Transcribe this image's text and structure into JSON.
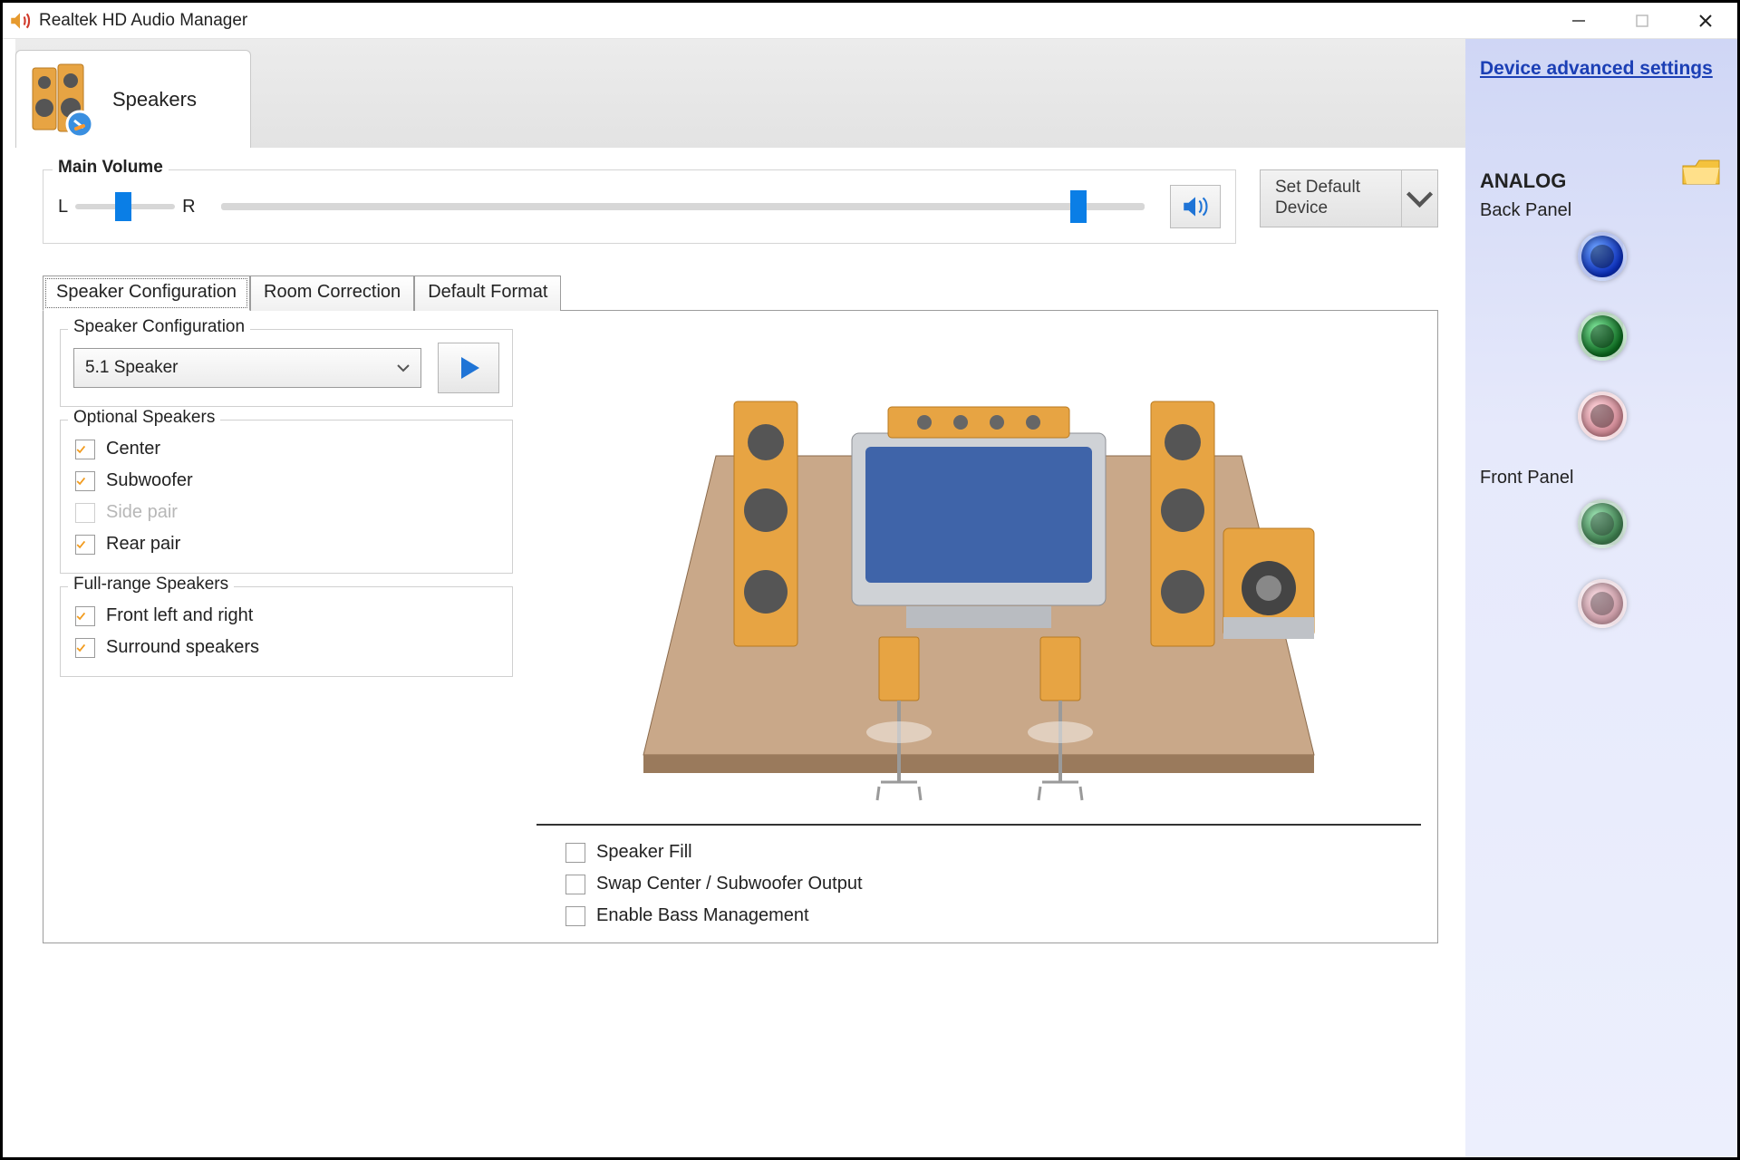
{
  "window": {
    "title": "Realtek HD Audio Manager"
  },
  "device_tab": {
    "label": "Speakers"
  },
  "main_volume": {
    "legend": "Main Volume",
    "left_label": "L",
    "right_label": "R",
    "balance_percent": 45,
    "volume_percent": 92,
    "default_device_label": "Set Default\nDevice"
  },
  "inner_tabs": {
    "items": [
      "Speaker Configuration",
      "Room Correction",
      "Default Format"
    ],
    "active_index": 0
  },
  "speaker_config": {
    "legend": "Speaker Configuration",
    "selected": "5.1 Speaker"
  },
  "optional_speakers": {
    "legend": "Optional Speakers",
    "items": [
      {
        "label": "Center",
        "checked": true,
        "disabled": false
      },
      {
        "label": "Subwoofer",
        "checked": true,
        "disabled": false
      },
      {
        "label": "Side pair",
        "checked": false,
        "disabled": true
      },
      {
        "label": "Rear pair",
        "checked": true,
        "disabled": false
      }
    ]
  },
  "full_range": {
    "legend": "Full-range Speakers",
    "items": [
      {
        "label": "Front left and right",
        "checked": true
      },
      {
        "label": "Surround speakers",
        "checked": true
      }
    ]
  },
  "extra_options": {
    "items": [
      {
        "label": "Speaker Fill",
        "checked": false
      },
      {
        "label": "Swap Center / Subwoofer Output",
        "checked": false
      },
      {
        "label": "Enable Bass Management",
        "checked": false
      }
    ]
  },
  "right_panel": {
    "link": "Device advanced settings",
    "analog_heading": "ANALOG",
    "back_label": "Back Panel",
    "front_label": "Front Panel",
    "back_jacks": [
      "blue",
      "green",
      "pink"
    ],
    "front_jacks": [
      "green",
      "pink"
    ]
  }
}
